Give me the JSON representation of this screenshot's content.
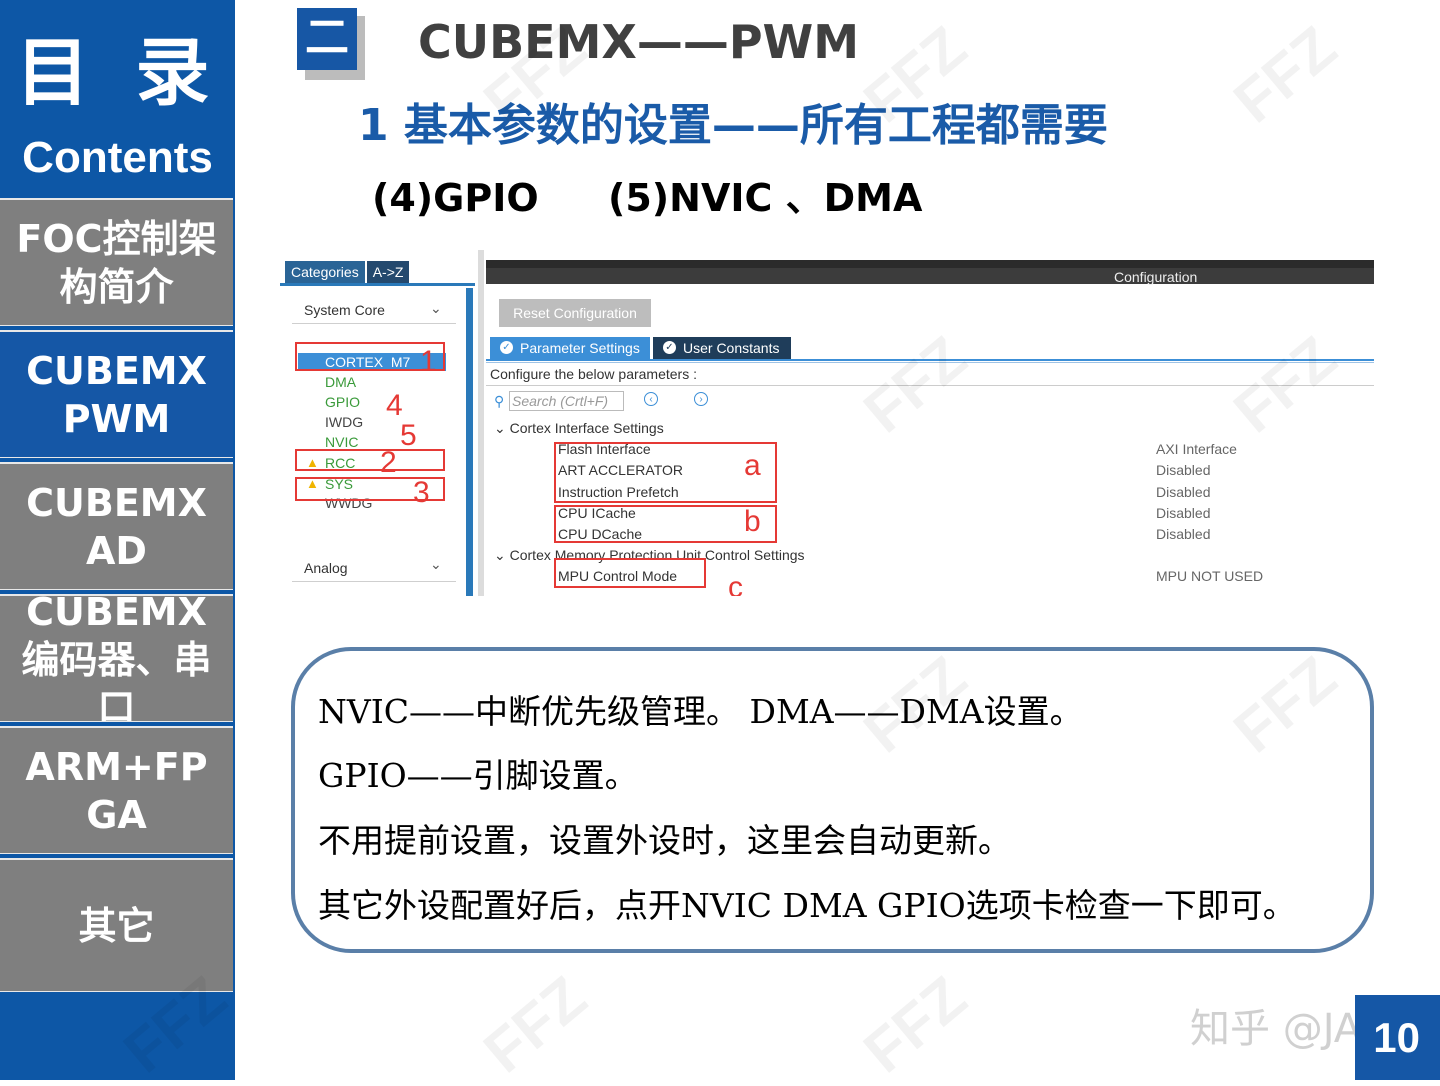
{
  "sidebar": {
    "toc_title": "目 录",
    "toc_subtitle": "Contents",
    "items": [
      {
        "label": "FOC控制架构简介"
      },
      {
        "label": "CUBEMX PWM"
      },
      {
        "label": "CUBEMX AD"
      },
      {
        "label": "CUBEMX编码器、串口"
      },
      {
        "label": "ARM+FPGA"
      },
      {
        "label": "其它"
      }
    ]
  },
  "header": {
    "section_badge": "二",
    "title": "CUBEMX——PWM",
    "subtitle": "1 基本参数的设置——所有工程都需要",
    "item_gpio": "(4)GPIO",
    "item_nvic": "(5)NVIC 、DMA"
  },
  "screenshot": {
    "left_tabs": [
      "Categories",
      "A->Z"
    ],
    "group_system_core": "System Core",
    "group_analog": "Analog",
    "system_core_items": [
      "CORTEX_M7",
      "DMA",
      "GPIO",
      "IWDG",
      "NVIC",
      "RCC",
      "SYS",
      "WWDG"
    ],
    "left_annotations": [
      "1",
      "4",
      "5",
      "2",
      "3"
    ],
    "configuration_title": "Configuration",
    "reset_button": "Reset Configuration",
    "tabs": [
      "Parameter Settings",
      "User Constants"
    ],
    "hint": "Configure the below parameters :",
    "search_placeholder": "Search (Crtl+F)",
    "section_cortex_interface": "Cortex Interface Settings",
    "section_mpu": "Cortex Memory Protection Unit Control Settings",
    "params": [
      {
        "name": "Flash Interface",
        "value": "AXI Interface"
      },
      {
        "name": "ART ACCLERATOR",
        "value": "Disabled"
      },
      {
        "name": "Instruction Prefetch",
        "value": "Disabled"
      },
      {
        "name": "CPU ICache",
        "value": "Disabled"
      },
      {
        "name": "CPU DCache",
        "value": "Disabled"
      },
      {
        "name": "MPU Control Mode",
        "value": "MPU NOT USED"
      }
    ],
    "right_annotations": [
      "a",
      "b",
      "c"
    ]
  },
  "note": {
    "line1": "NVIC——中断优先级管理。   DMA——DMA设置。",
    "line2": "GPIO——引脚设置。",
    "line3": "不用提前设置，设置外设时，这里会自动更新。",
    "line4": "其它外设配置好后，点开NVIC DMA GPIO选项卡检查一下即可。"
  },
  "watermark": "FFZ",
  "zhihu_credit": "知乎 @JAS",
  "page_number": "10",
  "colors": {
    "brand_blue": "#0d57a6",
    "nav_gray": "#7f7f7f",
    "title_blue": "#1a5ba8",
    "annotation_red": "#e53935"
  }
}
